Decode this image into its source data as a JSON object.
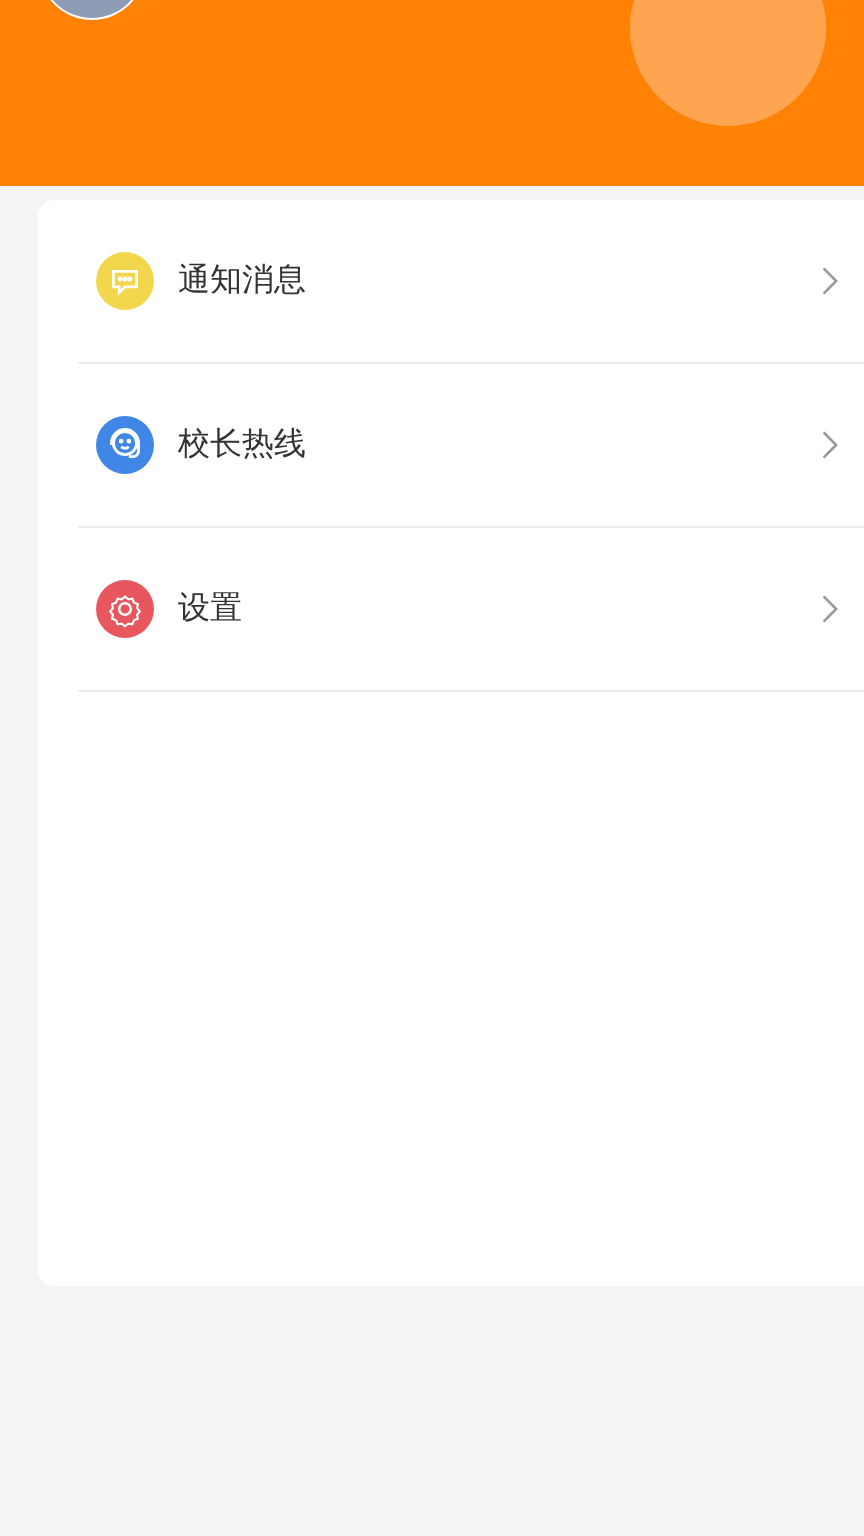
{
  "menu": [
    {
      "label": "通知消息",
      "kind": "message",
      "color": "#f2d64b"
    },
    {
      "label": "校长热线",
      "kind": "headset",
      "color": "#3f86e6"
    },
    {
      "label": "设置",
      "kind": "settings",
      "color": "#e8575d"
    }
  ]
}
